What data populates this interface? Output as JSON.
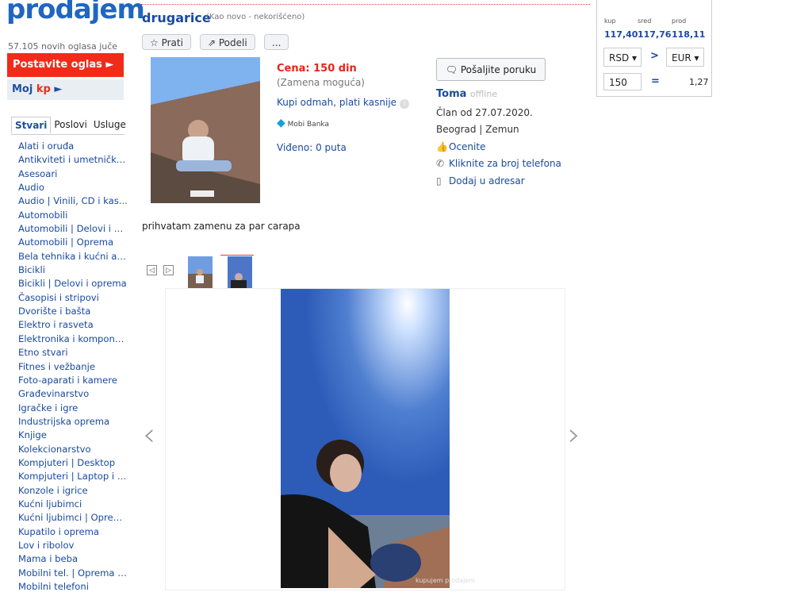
{
  "sidebar": {
    "logo": "prodajem",
    "stat": "57.105 novih oglasa juče",
    "post_button": "Postavite oglas ►",
    "moj_prefix": "Moj ",
    "moj_kp": "kp",
    "moj_arrow": " ►",
    "tabs": [
      "Stvari",
      "Poslovi",
      "Usluge"
    ],
    "categories": [
      "Alati i oruđa",
      "Antikviteti i umetnička...",
      "Asesoari",
      "Audio",
      "Audio | Vinili, CD i kas...",
      "Automobili",
      "Automobili | Delovi i a...",
      "Automobili | Oprema",
      "Bela tehnika i kućni ap...",
      "Bicikli",
      "Bicikli | Delovi i oprema",
      "Časopisi i stripovi",
      "Dvorište i bašta",
      "Elektro i rasveta",
      "Elektronika i kompone...",
      "Etno stvari",
      "Fitnes i vežbanje",
      "Foto-aparati i kamere",
      "Građevinarstvo",
      "Igračke i igre",
      "Industrijska oprema",
      "Knjige",
      "Kolekcionarstvo",
      "Kompjuteri | Desktop",
      "Kompjuteri | Laptop i t...",
      "Konzole i igrice",
      "Kućni ljubimci",
      "Kućni ljubimci | Oprema",
      "Kupatilo i oprema",
      "Lov i ribolov",
      "Mama i beba",
      "Mobilni tel. | Oprema i...",
      "Mobilni telefoni"
    ]
  },
  "ad": {
    "title": "drugarice",
    "condition": "(Kao novo - nekorišćeno)",
    "follow_label": "Prati",
    "share_label": "Podeli",
    "more_label": "...",
    "price": "Cena: 150 din",
    "exchange": "(Zamena moguća)",
    "buy_now": "Kupi odmah, plati kasnije",
    "mobi_banka": "Mobi Banka",
    "views": "Viđeno: 0 puta",
    "description": "prihvatam zamenu za par carapa",
    "watermark": "kupujem prodajem"
  },
  "seller": {
    "message_button": "Pošaljite poruku",
    "name": "Toma",
    "status": "offline",
    "member_since": "Član od 27.07.2020.",
    "location": "Beograd | Zemun",
    "rate": "Ocenite",
    "phone": "Kliknite za broj telefona",
    "address_book": "Dodaj u adresar"
  },
  "converter": {
    "labels": [
      "kup",
      "sred",
      "prod"
    ],
    "values": [
      "117,40",
      "117,76",
      "118,11"
    ],
    "from": "RSD ▾",
    "to": "EUR ▾",
    "arrow": ">",
    "amount": "150",
    "equals": "=",
    "result": "1,27"
  },
  "colors": {
    "brand_blue": "#1f66c1",
    "accent_red": "#f12b1a"
  }
}
